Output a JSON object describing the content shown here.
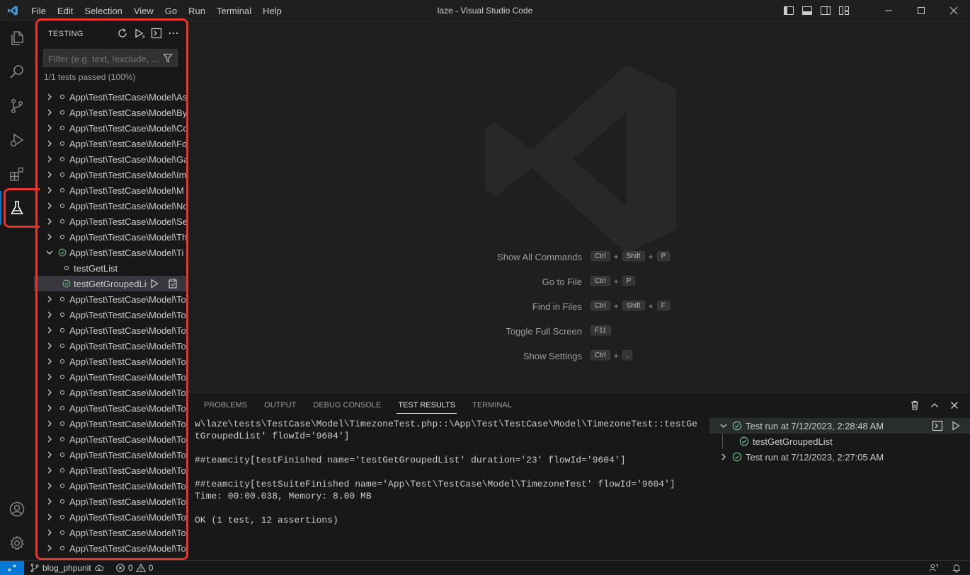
{
  "window": {
    "title": "laze - Visual Studio Code",
    "menu": [
      "File",
      "Edit",
      "Selection",
      "View",
      "Go",
      "Run",
      "Terminal",
      "Help"
    ]
  },
  "sidebar": {
    "title": "TESTING",
    "filter_placeholder": "Filter (e.g. text, !exclude, ...",
    "summary": "1/1 tests passed (100%)",
    "items": [
      {
        "label": "App\\Test\\TestCase\\Model\\As",
        "status": "idle",
        "expanded": false
      },
      {
        "label": "App\\Test\\TestCase\\Model\\By",
        "status": "idle",
        "expanded": false
      },
      {
        "label": "App\\Test\\TestCase\\Model\\Co",
        "status": "idle",
        "expanded": false
      },
      {
        "label": "App\\Test\\TestCase\\Model\\Fo",
        "status": "idle",
        "expanded": false
      },
      {
        "label": "App\\Test\\TestCase\\Model\\Ga",
        "status": "idle",
        "expanded": false
      },
      {
        "label": "App\\Test\\TestCase\\Model\\Im",
        "status": "idle",
        "expanded": false
      },
      {
        "label": "App\\Test\\TestCase\\Model\\M",
        "status": "idle",
        "expanded": false
      },
      {
        "label": "App\\Test\\TestCase\\Model\\No",
        "status": "idle",
        "expanded": false
      },
      {
        "label": "App\\Test\\TestCase\\Model\\Se",
        "status": "idle",
        "expanded": false
      },
      {
        "label": "App\\Test\\TestCase\\Model\\Th",
        "status": "idle",
        "expanded": false
      },
      {
        "label": "App\\Test\\TestCase\\Model\\Ti",
        "status": "passed",
        "expanded": true
      },
      {
        "label": "testGetList",
        "status": "idle",
        "child": true
      },
      {
        "label": "testGetGroupedList",
        "status": "passed",
        "child": true,
        "selected": true
      },
      {
        "label": "App\\Test\\TestCase\\Model\\To",
        "status": "idle",
        "expanded": false
      },
      {
        "label": "App\\Test\\TestCase\\Model\\To",
        "status": "idle",
        "expanded": false
      },
      {
        "label": "App\\Test\\TestCase\\Model\\To",
        "status": "idle",
        "expanded": false
      },
      {
        "label": "App\\Test\\TestCase\\Model\\To",
        "status": "idle",
        "expanded": false
      },
      {
        "label": "App\\Test\\TestCase\\Model\\To",
        "status": "idle",
        "expanded": false
      },
      {
        "label": "App\\Test\\TestCase\\Model\\To",
        "status": "idle",
        "expanded": false
      },
      {
        "label": "App\\Test\\TestCase\\Model\\To",
        "status": "idle",
        "expanded": false
      },
      {
        "label": "App\\Test\\TestCase\\Model\\To",
        "status": "idle",
        "expanded": false
      },
      {
        "label": "App\\Test\\TestCase\\Model\\To",
        "status": "idle",
        "expanded": false
      },
      {
        "label": "App\\Test\\TestCase\\Model\\To",
        "status": "idle",
        "expanded": false
      },
      {
        "label": "App\\Test\\TestCase\\Model\\To",
        "status": "idle",
        "expanded": false
      },
      {
        "label": "App\\Test\\TestCase\\Model\\To",
        "status": "idle",
        "expanded": false
      },
      {
        "label": "App\\Test\\TestCase\\Model\\To",
        "status": "idle",
        "expanded": false
      },
      {
        "label": "App\\Test\\TestCase\\Model\\To",
        "status": "idle",
        "expanded": false
      },
      {
        "label": "App\\Test\\TestCase\\Model\\To",
        "status": "idle",
        "expanded": false
      },
      {
        "label": "App\\Test\\TestCase\\Model\\To",
        "status": "idle",
        "expanded": false
      },
      {
        "label": "App\\Test\\TestCase\\Model\\To",
        "status": "idle",
        "expanded": false
      },
      {
        "label": "App\\Test\\TestCase\\Model\\To",
        "status": "idle",
        "expanded": false
      }
    ]
  },
  "editor": {
    "shortcuts": [
      {
        "name": "Show All Commands",
        "keys": [
          "Ctrl",
          "Shift",
          "P"
        ]
      },
      {
        "name": "Go to File",
        "keys": [
          "Ctrl",
          "P"
        ]
      },
      {
        "name": "Find in Files",
        "keys": [
          "Ctrl",
          "Shift",
          "F"
        ]
      },
      {
        "name": "Toggle Full Screen",
        "keys": [
          "F11"
        ]
      },
      {
        "name": "Show Settings",
        "keys": [
          "Ctrl",
          ","
        ]
      }
    ]
  },
  "panel": {
    "tabs": [
      "PROBLEMS",
      "OUTPUT",
      "DEBUG CONSOLE",
      "TEST RESULTS",
      "TERMINAL"
    ],
    "active_tab": "TEST RESULTS",
    "output_lines": [
      "w\\laze\\tests\\TestCase\\Model\\TimezoneTest.php::\\App\\Test\\TestCase\\Model\\TimezoneTest::testGe",
      "tGroupedList' flowId='9604']",
      "",
      "##teamcity[testFinished name='testGetGroupedList' duration='23' flowId='9604']",
      "",
      "##teamcity[testSuiteFinished name='App\\Test\\TestCase\\Model\\TimezoneTest' flowId='9604']",
      "Time: 00:00.038, Memory: 8.00 MB",
      "",
      "OK (1 test, 12 assertions)"
    ],
    "results": [
      {
        "label": "Test run at 7/12/2023, 2:28:48 AM",
        "expanded": true
      },
      {
        "label": "testGetGroupedList",
        "child": true
      },
      {
        "label": "Test run at 7/12/2023, 2:27:05 AM",
        "expanded": false
      }
    ]
  },
  "statusbar": {
    "branch": "blog_phpunit",
    "errors": "0",
    "warnings": "0"
  },
  "colors": {
    "accent": "#0078d4",
    "passed": "#73c991",
    "highlight": "#e8342b"
  }
}
